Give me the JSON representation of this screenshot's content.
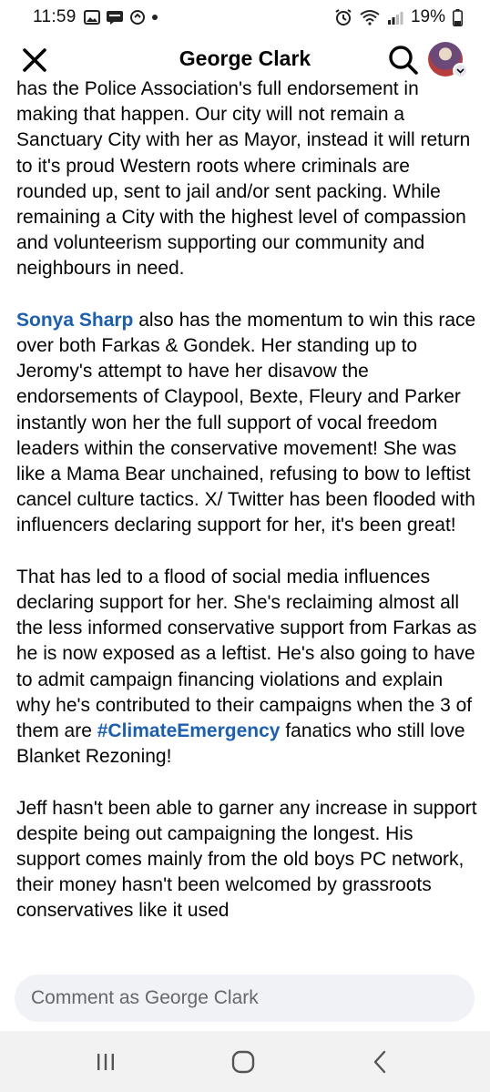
{
  "status_bar": {
    "time": "11:59",
    "battery": "19%"
  },
  "header": {
    "title": "George Clark"
  },
  "post": {
    "p1": "has the Police Association's full endorsement in making that happen. Our city will not remain a Sanctuary City with her as Mayor, instead it will return to it's proud Western roots where criminals are rounded up, sent to jail and/or sent packing. While remaining a City with the highest level of compassion and volunteerism supporting our community and neighbours in need.",
    "p2_link": "Sonya Sharp",
    "p2_rest": " also has the momentum to win this race over both Farkas & Gondek. Her standing up to Jeromy's attempt to have her disavow the endorsements of Claypool, Bexte, Fleury and Parker instantly won her the full support of vocal freedom leaders within the conservative movement! She was like a Mama Bear unchained, refusing to bow to leftist cancel culture tactics. X/ Twitter has been flooded with influencers declaring support for her, it's been great!",
    "p3_start": "That has led to a flood of social media influences declaring support for her. She's reclaiming almost all the less informed conservative support from Farkas as he is now exposed as a leftist. He's also going to have to admit campaign financing violations and explain why he's contributed to their campaigns when the 3 of them are ",
    "p3_hashtag": "#ClimateEmergency",
    "p3_end": " fanatics who still love Blanket Rezoning!",
    "p4": "Jeff hasn't been able to garner any increase in support despite being out campaigning the longest. His support comes mainly from the old boys PC network, their money hasn't been welcomed by grassroots conservatives like it used"
  },
  "comment": {
    "placeholder": "Comment as George Clark"
  },
  "icons": {
    "close": "close-icon",
    "search": "search-icon",
    "recents": "recents-icon",
    "home": "home-icon",
    "back": "back-icon"
  }
}
